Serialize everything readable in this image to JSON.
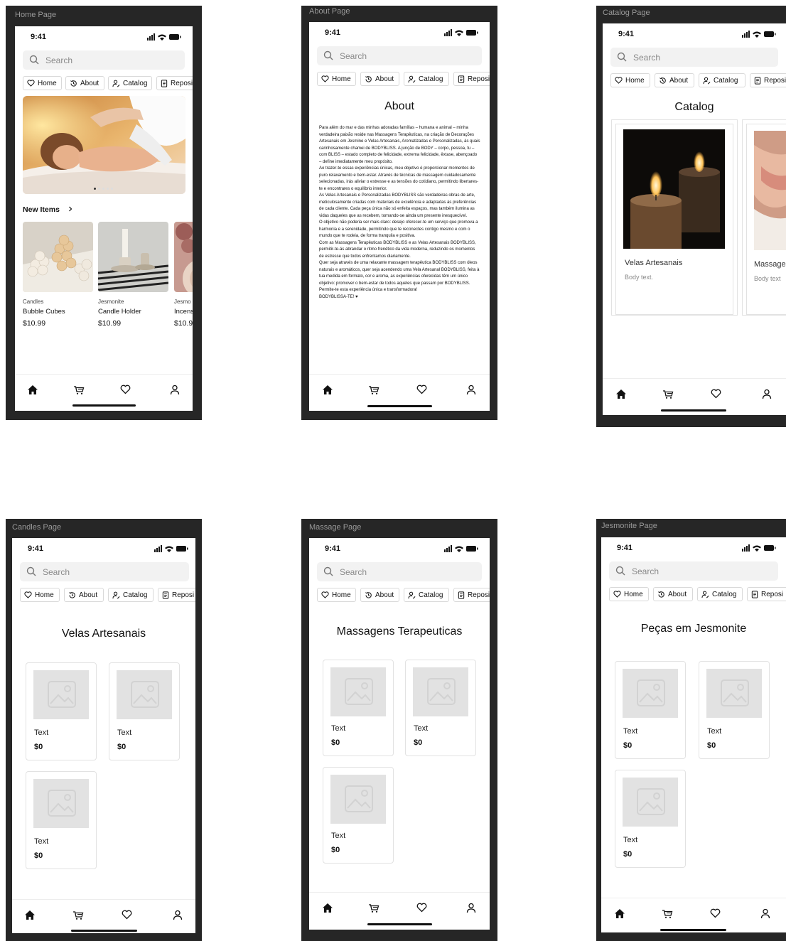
{
  "status": {
    "time": "9:41"
  },
  "search": {
    "placeholder": "Search"
  },
  "tabs": {
    "home": "Home",
    "about": "About",
    "catalog": "Catalog",
    "repo": "Reposi"
  },
  "nav_icons": [
    "home-icon",
    "cart-icon",
    "heart-icon",
    "profile-icon"
  ],
  "frames": {
    "home": {
      "label": "Home Page"
    },
    "about": {
      "label": "About Page"
    },
    "catalog": {
      "label": "Catalog Page"
    },
    "candles": {
      "label": "Candles Page"
    },
    "massage": {
      "label": "Massage Page"
    },
    "jesmonite": {
      "label": "Jesmonite Page"
    }
  },
  "home": {
    "section_title": "New Items",
    "items": [
      {
        "brand": "Candles",
        "name": "Bubble Cubes",
        "price": "$10.99"
      },
      {
        "brand": "Jesmonite",
        "name": "Candle Holder",
        "price": "$10.99"
      },
      {
        "brand": "Jesmo",
        "name": "Incens",
        "price": "$10.9"
      }
    ]
  },
  "about": {
    "title": "About",
    "paragraphs": [
      "Para além do mar e das minhas adoradas famílias – humana e animal – minha verdadeira paixão reside nas Massagens Terapêuticas, na criação de Decorações Artesanais em Jesmine e Velas Artesanais, Aromatizadas e Personalizadas, às quais carinhosamente chamei de BODYBLISS. A junção de BODY – corpo, pessoa, tu – com BLISS – estado completo de felicidade, extrema felicidade, êxtase, abençoado – define imediatamente meu propósito.",
      "Ao trazer-te essas experiências únicas, meu objetivo é proporcionar momentos de puro relaxamento e bem-estar. Através de técnicas de massagem cuidadosamente selecionadas, irás aliviar o estresse e as tensões do cotidiano, permitindo libertares-te e encontrares o equilíbrio interior.",
      "As Velas Artesanais e Personalizadas BODYBLISS são verdadeiras obras de arte, meticulosamente criadas com materiais de excelência e adaptadas às preferências de cada cliente. Cada peça única não só enfeita espaços, mas também ilumina as vidas daqueles que as recebem, tornando-se ainda um presente inesquecível.",
      "O objetivo não poderia ser mais claro: desejo oferecer-te um serviço que promova a harmonia e a serenidade, permitindo que te reconectes contigo mesmo e com o mundo que te rodeia, de forma tranquila e positiva.",
      "Com as Massagens Terapêuticas BODYBLISS e as Velas Artesanais BODYBLISS, permitir-te-ás abrandar o ritmo frenético da vida moderna, reduzindo os momentos de estresse que todos enfrentamos diariamente.",
      "Quer seja através de uma relaxante massagem terapêutica BODYBLISS com óleos naturais e aromáticos, quer seja acendendo uma Vela Artesanal BODYBLISS, feita à tua medida em formato, cor e aroma, as experiências oferecidas têm um único objetivo: promover o bem-estar de todos aqueles que passam por BODYBLISS.",
      "Permite-te esta experiência única e transformadora!",
      "BODYBLISSA-TE! ♥"
    ]
  },
  "catalog": {
    "title": "Catalog",
    "cards": [
      {
        "title": "Velas Artesanais",
        "body": "Body text."
      },
      {
        "title": "Massage",
        "body": "Body text"
      }
    ]
  },
  "candles": {
    "title": "Velas Artesanais",
    "products": [
      {
        "title": "Text",
        "price": "$0"
      },
      {
        "title": "Text",
        "price": "$0"
      },
      {
        "title": "Text",
        "price": "$0"
      }
    ]
  },
  "massage": {
    "title": "Massagens Terapeuticas",
    "products": [
      {
        "title": "Text",
        "price": "$0"
      },
      {
        "title": "Text",
        "price": "$0"
      },
      {
        "title": "Text",
        "price": "$0"
      }
    ]
  },
  "jesmonite": {
    "title": "Peças em Jesmonite",
    "products": [
      {
        "title": "Text",
        "price": "$0"
      },
      {
        "title": "Text",
        "price": "$0"
      },
      {
        "title": "Text",
        "price": "$0"
      }
    ]
  }
}
